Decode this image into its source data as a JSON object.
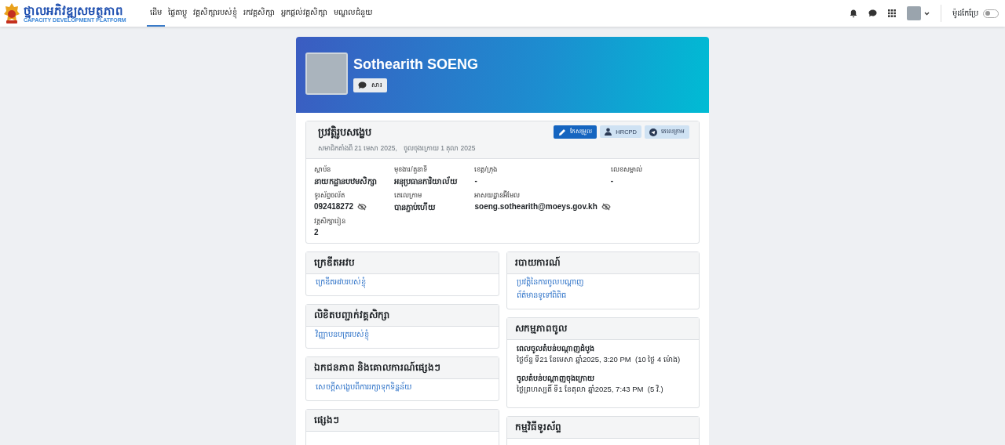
{
  "brand": {
    "title": "ថ្នាលអភិវឌ្ឍសមត្ថភាព",
    "subtitle": "CAPACITY DEVELOPMENT PLATFORM"
  },
  "nav": [
    {
      "label": "ដើម",
      "selected": true
    },
    {
      "label": "ផ្ទៃតាប្លូ",
      "selected": false
    },
    {
      "label": "វគ្គសិក្សារបស់ខ្ញុំ",
      "selected": false
    },
    {
      "label": "រកវគ្គសិក្សា",
      "selected": false
    },
    {
      "label": "អ្នកផ្តល់វគ្គសិក្សា",
      "selected": false
    },
    {
      "label": "មណ្ឌលជំនួយ",
      "selected": false
    }
  ],
  "mode_toggle": {
    "label": "ម៉ូដកែប្រែ",
    "on": false
  },
  "profile": {
    "name": "Sothearith SOENG",
    "message_button": "សារ"
  },
  "summary": {
    "title": "ប្រវត្តិរូបសង្ខេប",
    "member_since": "សមាជិកតាំងពី 21 មេសា 2025,",
    "last_access": "ចូលចុងក្រោយ 1 តុលា 2025",
    "buttons": [
      {
        "label": "កែសម្រួល",
        "kind": "primary"
      },
      {
        "label": "HRCPD",
        "kind": "light"
      },
      {
        "label": "តេលេក្រាម",
        "kind": "light"
      }
    ],
    "fields": [
      {
        "label": "ស្ថាប័ន",
        "value": "នាយកដ្ឋានបឋមសិក្សា",
        "revealable": false
      },
      {
        "label": "មុខងារ/តួនាទី",
        "value": "អនុប្រធានការិយាល័យ",
        "revealable": false
      },
      {
        "label": "ខេត្ត/ក្រុង",
        "value": "-",
        "revealable": false
      },
      {
        "label": "លេខសម្គាល់",
        "value": "-",
        "revealable": false
      },
      {
        "label": "ទូរស័ព្ទចល័ត",
        "value": "092418272",
        "revealable": true
      },
      {
        "label": "តេលេក្រាម",
        "value": "បានភ្ជាប់ហើយ",
        "revealable": false
      },
      {
        "label": "អាសយដ្ឋានអ៊ីមែល",
        "value": "soeng.sothearith@moeys.gov.kh",
        "revealable": true
      },
      {
        "label": "វគ្គសិក្សារៀន",
        "value": "2",
        "revealable": false
      }
    ]
  },
  "left_panels": [
    {
      "title": "ក្រេឌីតអវប",
      "kind": "links",
      "links": [
        "ក្រេឌីតអវបរបស់ខ្ញុំ"
      ]
    },
    {
      "title": "លិខិតបញ្ជាក់វគ្គសិក្សា",
      "kind": "links",
      "links": [
        "វិញ្ញាបនបត្ររបស់ខ្ញុំ"
      ]
    },
    {
      "title": "ឯកជនភាព និងគោលការណ៍ផ្សេងៗ",
      "kind": "links",
      "links": [
        "សេចក្តីសង្ខេបពីការរក្សាទុកទិន្នន័យ"
      ]
    },
    {
      "title": "ផ្សេងៗ",
      "kind": "links"
    }
  ],
  "right_panels": [
    {
      "title": "របាយការណ៍",
      "kind": "links",
      "links": [
        "ប្រវត្តិនៃការចូលបណ្តាញ",
        "ព័ត៌មានទូទៅពិពិធ"
      ]
    },
    {
      "title": "សកម្មភាពចូល",
      "kind": "entries",
      "entries": [
        {
          "label": "ពេលចូលតំបន់បណ្តាញដំបូង",
          "value": "ថ្ងៃច័ន្ទ ទី21 ខែមេសា ឆ្នាំ2025, 3:20 PM  (10 ថ្ងៃ 4 ម៉ោង)"
        },
        {
          "label": "ចូលតំបន់បណ្តាញចុងក្រោយ",
          "value": "ថ្ងៃព្រហស្បតិ៍ ទី1 ខែតុលា ឆ្នាំ2025, 7:43 PM  (5 វិ.)"
        }
      ]
    },
    {
      "title": "កម្មវិធីទូរស័ព្ទ",
      "kind": "links"
    }
  ]
}
